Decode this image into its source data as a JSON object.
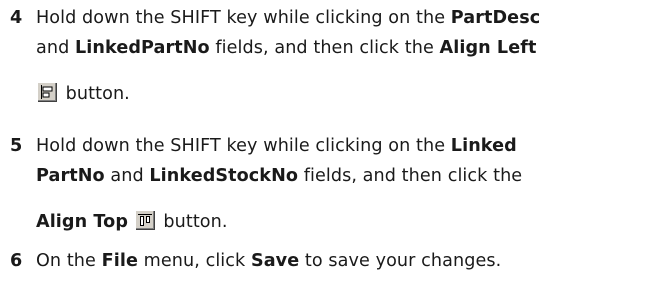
{
  "steps": [
    {
      "number": "4",
      "lines": [
        [
          {
            "t": "Hold down the SHIFT key while clicking on the "
          },
          {
            "t": "PartDesc",
            "b": true
          }
        ],
        [
          {
            "t": "and "
          },
          {
            "t": "LinkedPartNo",
            "b": true
          },
          {
            "t": " fields, and then click the "
          },
          {
            "t": "Align Left",
            "b": true
          }
        ],
        [
          {
            "icon": "align-left-icon"
          },
          {
            "t": " button."
          }
        ]
      ]
    },
    {
      "number": "5",
      "lines": [
        [
          {
            "t": "Hold down the SHIFT key while clicking on the "
          },
          {
            "t": "Linked",
            "b": true
          }
        ],
        [
          {
            "t": "PartNo",
            "b": true
          },
          {
            "t": " and "
          },
          {
            "t": "LinkedStockNo",
            "b": true
          },
          {
            "t": " fields, and then click the"
          }
        ],
        [
          {
            "t": "Align Top",
            "b": true
          },
          {
            "t": " "
          },
          {
            "icon": "align-top-icon"
          },
          {
            "t": " button."
          }
        ]
      ]
    },
    {
      "number": "6",
      "lines": [
        [
          {
            "t": "On the "
          },
          {
            "t": "File",
            "b": true
          },
          {
            "t": " menu, click "
          },
          {
            "t": "Save",
            "b": true
          },
          {
            "t": " to save your changes."
          }
        ]
      ]
    }
  ]
}
